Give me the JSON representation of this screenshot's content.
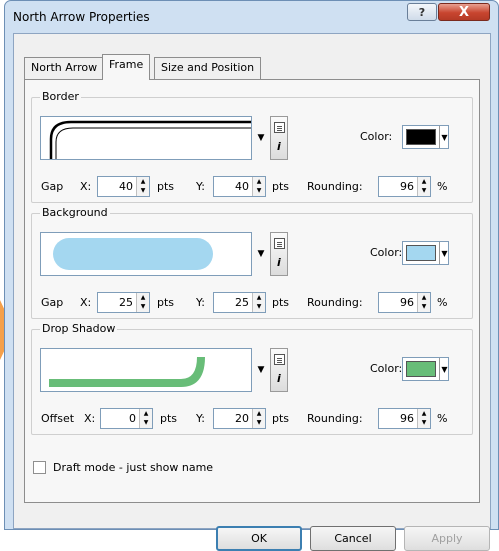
{
  "window": {
    "title": "North Arrow Properties",
    "help_button": "?",
    "close_button": "X"
  },
  "tabs": [
    {
      "label": "North Arrow"
    },
    {
      "label": "Frame"
    },
    {
      "label": "Size and Position"
    }
  ],
  "border": {
    "title": "Border",
    "color_label": "Color:",
    "color": "#000000",
    "gap_label": "Gap",
    "x_label": "X:",
    "x_value": "40",
    "x_unit": "pts",
    "y_label": "Y:",
    "y_value": "40",
    "y_unit": "pts",
    "rounding_label": "Rounding:",
    "rounding_value": "96",
    "rounding_unit": "%"
  },
  "background": {
    "title": "Background",
    "color_label": "Color:",
    "color": "#a4d7f0",
    "gap_label": "Gap",
    "x_label": "X:",
    "x_value": "25",
    "x_unit": "pts",
    "y_label": "Y:",
    "y_value": "25",
    "y_unit": "pts",
    "rounding_label": "Rounding:",
    "rounding_value": "96",
    "rounding_unit": "%"
  },
  "drop_shadow": {
    "title": "Drop Shadow",
    "color_label": "Color:",
    "color": "#68bd78",
    "gap_label": "Offset",
    "x_label": "X:",
    "x_value": "0",
    "x_unit": "pts",
    "y_label": "Y:",
    "y_value": "20",
    "y_unit": "pts",
    "rounding_label": "Rounding:",
    "rounding_value": "96",
    "rounding_unit": "%"
  },
  "draft_mode": {
    "label": "Draft mode - just show name",
    "checked": false
  },
  "buttons": {
    "ok": "OK",
    "cancel": "Cancel",
    "apply": "Apply"
  }
}
